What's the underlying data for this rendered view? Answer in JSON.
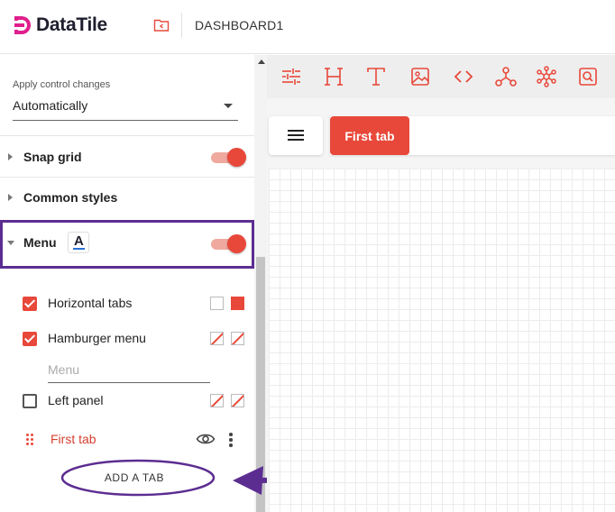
{
  "app": {
    "name": "DataTile",
    "dashboard_title": "DASHBOARD1"
  },
  "controls": {
    "apply_label": "Apply control changes",
    "apply_value": "Automatically"
  },
  "sections": {
    "snap_grid": "Snap grid",
    "common_styles": "Common styles",
    "menu": "Menu",
    "menu_icon_letter": "A"
  },
  "menu_options": {
    "horizontal_tabs": "Horizontal tabs",
    "hamburger_menu": "Hamburger menu",
    "menu_placeholder": "Menu",
    "left_panel": "Left panel"
  },
  "tab_item": {
    "label": "First tab"
  },
  "add_tab_label": "ADD A TAB",
  "canvas": {
    "first_tab": "First tab"
  },
  "toolbar_icons": [
    "filters-icon",
    "heading-icon",
    "text-icon",
    "image-icon",
    "code-icon",
    "network-icon",
    "graph-icon",
    "search-box-icon"
  ],
  "colors": {
    "accent": "#e8483a",
    "annotation": "#5c2d91"
  }
}
